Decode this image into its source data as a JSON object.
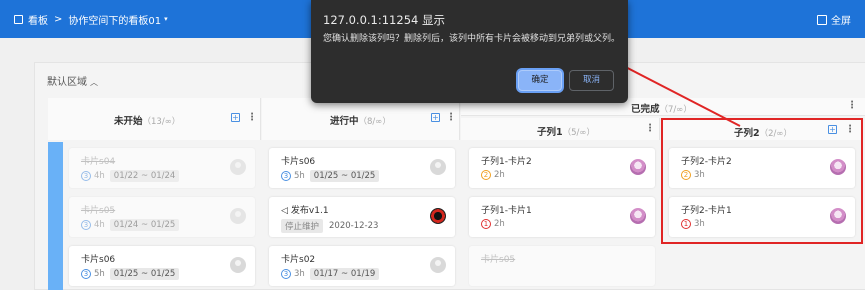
{
  "topbar": {
    "breadcrumb_root": "看板",
    "breadcrumb_sep": ">",
    "breadcrumb_board": "协作空间下的看板01",
    "breadcrumb_caret": "▾",
    "fullscreen_label": "全屏"
  },
  "area": {
    "title": "默认区域",
    "chevron": "︿"
  },
  "columns": [
    {
      "name": "未开始",
      "count": "（13/∞）"
    },
    {
      "name": "进行中",
      "count": "（8/∞）"
    },
    {
      "name": "已完成",
      "count": "（7/∞）"
    },
    {
      "name": "子列1",
      "count": "（5/∞）"
    },
    {
      "name": "子列2",
      "count": "（2/∞）"
    }
  ],
  "cards": {
    "col1": [
      {
        "title": "卡片s04",
        "est": "4h",
        "dates": "01/22 ~ 01/24",
        "badge": "3"
      },
      {
        "title": "卡片s05",
        "est": "4h",
        "dates": "01/24 ~ 01/25",
        "badge": "3"
      },
      {
        "title": "卡片s06",
        "est": "5h",
        "dates": "01/25 ~ 01/25",
        "badge": "3"
      }
    ],
    "col2": [
      {
        "title": "卡片s06",
        "est": "5h",
        "dates": "01/25 ~ 01/25",
        "badge": "3"
      },
      {
        "title": "发布v1.1",
        "tag": "停止维护",
        "date": "2020-12-23",
        "flag": "◁"
      },
      {
        "title": "卡片s02",
        "est": "3h",
        "dates": "01/17 ~ 01/19",
        "badge": "3"
      }
    ],
    "sub1": [
      {
        "title": "子列1-卡片2",
        "est": "2h",
        "badge": "2"
      },
      {
        "title": "子列1-卡片1",
        "est": "2h",
        "badge": "1"
      },
      {
        "title": "卡片s05"
      }
    ],
    "sub2": [
      {
        "title": "子列2-卡片2",
        "est": "3h",
        "badge": "2"
      },
      {
        "title": "子列2-卡片1",
        "est": "3h",
        "badge": "1"
      }
    ]
  },
  "dialog": {
    "host": "127.0.0.1:11254 显示",
    "message": "您确认删除该列吗？删除列后，该列中所有卡片会被移动到兄弟列或父列。",
    "ok_label": "确定",
    "cancel_label": "取消"
  },
  "colors": {
    "topbar": "#1e73d8",
    "strip": "#69b1f7",
    "highlight": "#e02525",
    "dialog_bg": "#2d2d2d"
  }
}
